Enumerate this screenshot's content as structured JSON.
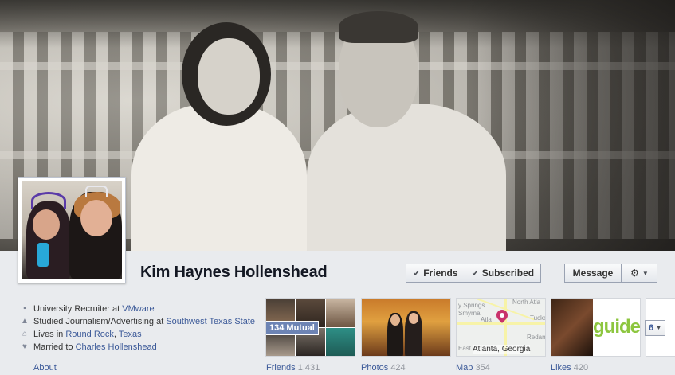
{
  "profile": {
    "name": "Kim Haynes Hollenshead"
  },
  "actions": {
    "friends_label": "Friends",
    "subscribed_label": "Subscribed",
    "message_label": "Message"
  },
  "about": {
    "rows": [
      {
        "icon": "briefcase-icon",
        "prefix": "University Recruiter at ",
        "link": "VMware"
      },
      {
        "icon": "graduation-icon",
        "prefix": "Studied Journalism/Advertising at ",
        "link": "Southwest Texas State"
      },
      {
        "icon": "home-icon",
        "prefix": "Lives in ",
        "link": "Round Rock",
        "sep": ", ",
        "link2": "Texas"
      },
      {
        "icon": "heart-icon",
        "prefix": "Married to ",
        "link": "Charles Hollenshead"
      }
    ],
    "label": "About"
  },
  "tabs": {
    "friends": {
      "label": "Friends",
      "count": "1,431",
      "mutual": "134 Mutual"
    },
    "photos": {
      "label": "Photos",
      "count": "424"
    },
    "map": {
      "label": "Map",
      "count": "354",
      "caption": "Atlanta, Georgia"
    },
    "likes": {
      "label": "Likes",
      "count": "420",
      "brand": "guide"
    }
  },
  "map_labels": {
    "north_atlanta": "North Atla",
    "smyrna": "Smyrna",
    "atlanta": "Atla",
    "tucker": "Tucke",
    "springs": "y Springs",
    "redan": "Redan",
    "east": "East"
  },
  "more": {
    "count": "6"
  },
  "colors": {
    "link": "#3b5998",
    "mutual_badge": "#6d84b4",
    "name": "#141823"
  }
}
